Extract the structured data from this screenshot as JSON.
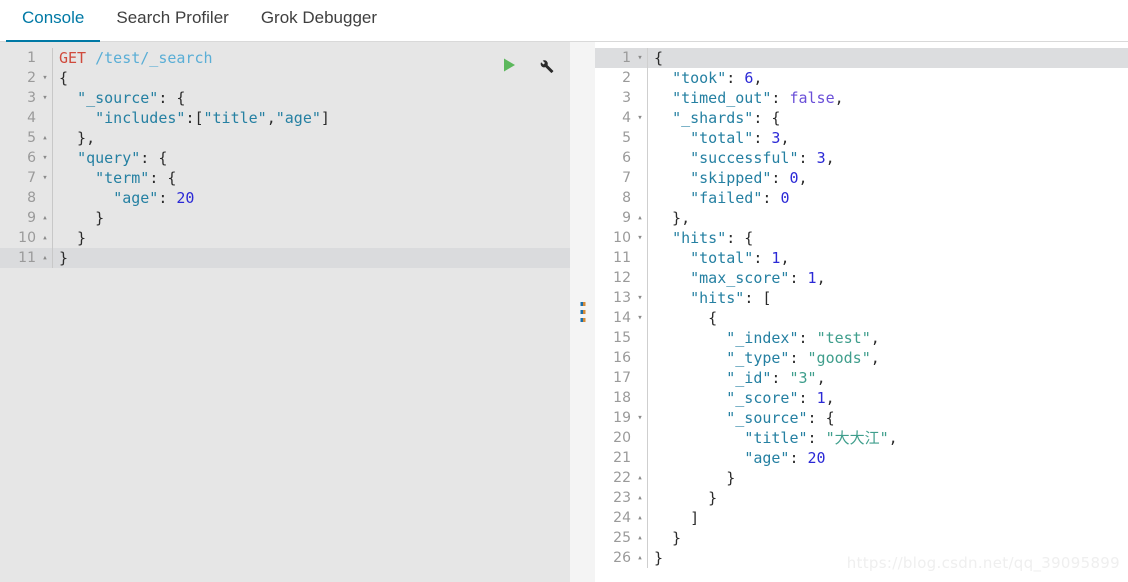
{
  "tabs": [
    {
      "label": "Console",
      "active": true
    },
    {
      "label": "Search Profiler",
      "active": false
    },
    {
      "label": "Grok Debugger",
      "active": false
    }
  ],
  "colors": {
    "accent": "#0079a5",
    "play_green": "#5cb85c",
    "wrench_black": "#2b2b2b",
    "editor_bg": "#e6e6e6",
    "active_line": "#dadbdd"
  },
  "actions": {
    "play_icon": "play-icon",
    "play_title": "Click to send request",
    "wrench_icon": "wrench-icon",
    "wrench_title": "Settings"
  },
  "splitter": {
    "icon": "drag-handle-icon"
  },
  "request_editor": {
    "name": "console-request-editor",
    "active_line": 11,
    "lines": [
      {
        "n": 1,
        "fold": "",
        "tokens": [
          {
            "t": "GET",
            "c": "k-method"
          },
          {
            "t": " ",
            "c": "k-plain"
          },
          {
            "t": "/test/_search",
            "c": "k-url"
          }
        ]
      },
      {
        "n": 2,
        "fold": "▾",
        "tokens": [
          {
            "t": "{",
            "c": "k-punct"
          }
        ]
      },
      {
        "n": 3,
        "fold": "▾",
        "tokens": [
          {
            "t": "  ",
            "c": "k-plain"
          },
          {
            "t": "\"_source\"",
            "c": "k-key"
          },
          {
            "t": ": {",
            "c": "k-punct"
          }
        ]
      },
      {
        "n": 4,
        "fold": "",
        "tokens": [
          {
            "t": "    ",
            "c": "k-plain"
          },
          {
            "t": "\"includes\"",
            "c": "k-key"
          },
          {
            "t": ":[",
            "c": "k-punct"
          },
          {
            "t": "\"title\"",
            "c": "k-key"
          },
          {
            "t": ",",
            "c": "k-punct"
          },
          {
            "t": "\"age\"",
            "c": "k-key"
          },
          {
            "t": "]",
            "c": "k-punct"
          }
        ]
      },
      {
        "n": 5,
        "fold": "▴",
        "tokens": [
          {
            "t": "  },",
            "c": "k-punct"
          }
        ]
      },
      {
        "n": 6,
        "fold": "▾",
        "tokens": [
          {
            "t": "  ",
            "c": "k-plain"
          },
          {
            "t": "\"query\"",
            "c": "k-key"
          },
          {
            "t": ": {",
            "c": "k-punct"
          }
        ]
      },
      {
        "n": 7,
        "fold": "▾",
        "tokens": [
          {
            "t": "    ",
            "c": "k-plain"
          },
          {
            "t": "\"term\"",
            "c": "k-key"
          },
          {
            "t": ": {",
            "c": "k-punct"
          }
        ]
      },
      {
        "n": 8,
        "fold": "",
        "tokens": [
          {
            "t": "      ",
            "c": "k-plain"
          },
          {
            "t": "\"age\"",
            "c": "k-key"
          },
          {
            "t": ": ",
            "c": "k-punct"
          },
          {
            "t": "20",
            "c": "k-num"
          }
        ]
      },
      {
        "n": 9,
        "fold": "▴",
        "tokens": [
          {
            "t": "    }",
            "c": "k-punct"
          }
        ]
      },
      {
        "n": 10,
        "fold": "▴",
        "tokens": [
          {
            "t": "  }",
            "c": "k-punct"
          }
        ]
      },
      {
        "n": 11,
        "fold": "▴",
        "tokens": [
          {
            "t": "}",
            "c": "k-punct"
          }
        ]
      }
    ]
  },
  "response_editor": {
    "name": "console-response-viewer",
    "active_line": 1,
    "lines": [
      {
        "n": 1,
        "fold": "▾",
        "tokens": [
          {
            "t": "{",
            "c": "k-punct"
          }
        ]
      },
      {
        "n": 2,
        "fold": "",
        "tokens": [
          {
            "t": "  ",
            "c": "k-plain"
          },
          {
            "t": "\"took\"",
            "c": "k-key"
          },
          {
            "t": ": ",
            "c": "k-punct"
          },
          {
            "t": "6",
            "c": "k-num"
          },
          {
            "t": ",",
            "c": "k-punct"
          }
        ]
      },
      {
        "n": 3,
        "fold": "",
        "tokens": [
          {
            "t": "  ",
            "c": "k-plain"
          },
          {
            "t": "\"timed_out\"",
            "c": "k-key"
          },
          {
            "t": ": ",
            "c": "k-punct"
          },
          {
            "t": "false",
            "c": "k-bool"
          },
          {
            "t": ",",
            "c": "k-punct"
          }
        ]
      },
      {
        "n": 4,
        "fold": "▾",
        "tokens": [
          {
            "t": "  ",
            "c": "k-plain"
          },
          {
            "t": "\"_shards\"",
            "c": "k-key"
          },
          {
            "t": ": {",
            "c": "k-punct"
          }
        ]
      },
      {
        "n": 5,
        "fold": "",
        "tokens": [
          {
            "t": "    ",
            "c": "k-plain"
          },
          {
            "t": "\"total\"",
            "c": "k-key"
          },
          {
            "t": ": ",
            "c": "k-punct"
          },
          {
            "t": "3",
            "c": "k-num"
          },
          {
            "t": ",",
            "c": "k-punct"
          }
        ]
      },
      {
        "n": 6,
        "fold": "",
        "tokens": [
          {
            "t": "    ",
            "c": "k-plain"
          },
          {
            "t": "\"successful\"",
            "c": "k-key"
          },
          {
            "t": ": ",
            "c": "k-punct"
          },
          {
            "t": "3",
            "c": "k-num"
          },
          {
            "t": ",",
            "c": "k-punct"
          }
        ]
      },
      {
        "n": 7,
        "fold": "",
        "tokens": [
          {
            "t": "    ",
            "c": "k-plain"
          },
          {
            "t": "\"skipped\"",
            "c": "k-key"
          },
          {
            "t": ": ",
            "c": "k-punct"
          },
          {
            "t": "0",
            "c": "k-num"
          },
          {
            "t": ",",
            "c": "k-punct"
          }
        ]
      },
      {
        "n": 8,
        "fold": "",
        "tokens": [
          {
            "t": "    ",
            "c": "k-plain"
          },
          {
            "t": "\"failed\"",
            "c": "k-key"
          },
          {
            "t": ": ",
            "c": "k-punct"
          },
          {
            "t": "0",
            "c": "k-num"
          }
        ]
      },
      {
        "n": 9,
        "fold": "▴",
        "tokens": [
          {
            "t": "  },",
            "c": "k-punct"
          }
        ]
      },
      {
        "n": 10,
        "fold": "▾",
        "tokens": [
          {
            "t": "  ",
            "c": "k-plain"
          },
          {
            "t": "\"hits\"",
            "c": "k-key"
          },
          {
            "t": ": {",
            "c": "k-punct"
          }
        ]
      },
      {
        "n": 11,
        "fold": "",
        "tokens": [
          {
            "t": "    ",
            "c": "k-plain"
          },
          {
            "t": "\"total\"",
            "c": "k-key"
          },
          {
            "t": ": ",
            "c": "k-punct"
          },
          {
            "t": "1",
            "c": "k-num"
          },
          {
            "t": ",",
            "c": "k-punct"
          }
        ]
      },
      {
        "n": 12,
        "fold": "",
        "tokens": [
          {
            "t": "    ",
            "c": "k-plain"
          },
          {
            "t": "\"max_score\"",
            "c": "k-key"
          },
          {
            "t": ": ",
            "c": "k-punct"
          },
          {
            "t": "1",
            "c": "k-num"
          },
          {
            "t": ",",
            "c": "k-punct"
          }
        ]
      },
      {
        "n": 13,
        "fold": "▾",
        "tokens": [
          {
            "t": "    ",
            "c": "k-plain"
          },
          {
            "t": "\"hits\"",
            "c": "k-key"
          },
          {
            "t": ": [",
            "c": "k-punct"
          }
        ]
      },
      {
        "n": 14,
        "fold": "▾",
        "tokens": [
          {
            "t": "      {",
            "c": "k-punct"
          }
        ]
      },
      {
        "n": 15,
        "fold": "",
        "tokens": [
          {
            "t": "        ",
            "c": "k-plain"
          },
          {
            "t": "\"_index\"",
            "c": "k-key"
          },
          {
            "t": ": ",
            "c": "k-punct"
          },
          {
            "t": "\"test\"",
            "c": "k-str"
          },
          {
            "t": ",",
            "c": "k-punct"
          }
        ]
      },
      {
        "n": 16,
        "fold": "",
        "tokens": [
          {
            "t": "        ",
            "c": "k-plain"
          },
          {
            "t": "\"_type\"",
            "c": "k-key"
          },
          {
            "t": ": ",
            "c": "k-punct"
          },
          {
            "t": "\"goods\"",
            "c": "k-str"
          },
          {
            "t": ",",
            "c": "k-punct"
          }
        ]
      },
      {
        "n": 17,
        "fold": "",
        "tokens": [
          {
            "t": "        ",
            "c": "k-plain"
          },
          {
            "t": "\"_id\"",
            "c": "k-key"
          },
          {
            "t": ": ",
            "c": "k-punct"
          },
          {
            "t": "\"3\"",
            "c": "k-str"
          },
          {
            "t": ",",
            "c": "k-punct"
          }
        ]
      },
      {
        "n": 18,
        "fold": "",
        "tokens": [
          {
            "t": "        ",
            "c": "k-plain"
          },
          {
            "t": "\"_score\"",
            "c": "k-key"
          },
          {
            "t": ": ",
            "c": "k-punct"
          },
          {
            "t": "1",
            "c": "k-num"
          },
          {
            "t": ",",
            "c": "k-punct"
          }
        ]
      },
      {
        "n": 19,
        "fold": "▾",
        "tokens": [
          {
            "t": "        ",
            "c": "k-plain"
          },
          {
            "t": "\"_source\"",
            "c": "k-key"
          },
          {
            "t": ": {",
            "c": "k-punct"
          }
        ]
      },
      {
        "n": 20,
        "fold": "",
        "tokens": [
          {
            "t": "          ",
            "c": "k-plain"
          },
          {
            "t": "\"title\"",
            "c": "k-key"
          },
          {
            "t": ": ",
            "c": "k-punct"
          },
          {
            "t": "\"大大江\"",
            "c": "k-str"
          },
          {
            "t": ",",
            "c": "k-punct"
          }
        ]
      },
      {
        "n": 21,
        "fold": "",
        "tokens": [
          {
            "t": "          ",
            "c": "k-plain"
          },
          {
            "t": "\"age\"",
            "c": "k-key"
          },
          {
            "t": ": ",
            "c": "k-punct"
          },
          {
            "t": "20",
            "c": "k-num"
          }
        ]
      },
      {
        "n": 22,
        "fold": "▴",
        "tokens": [
          {
            "t": "        }",
            "c": "k-punct"
          }
        ]
      },
      {
        "n": 23,
        "fold": "▴",
        "tokens": [
          {
            "t": "      }",
            "c": "k-punct"
          }
        ]
      },
      {
        "n": 24,
        "fold": "▴",
        "tokens": [
          {
            "t": "    ]",
            "c": "k-punct"
          }
        ]
      },
      {
        "n": 25,
        "fold": "▴",
        "tokens": [
          {
            "t": "  }",
            "c": "k-punct"
          }
        ]
      },
      {
        "n": 26,
        "fold": "▴",
        "tokens": [
          {
            "t": "}",
            "c": "k-punct"
          }
        ]
      }
    ]
  },
  "watermark": {
    "text": "https://blog.csdn.net/qq_39095899"
  }
}
